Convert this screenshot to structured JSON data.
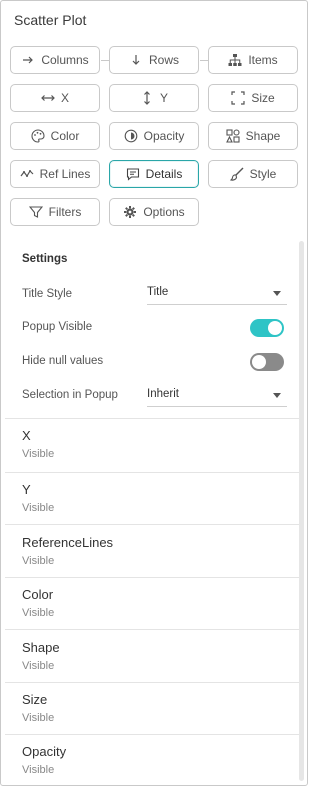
{
  "panel": {
    "title": "Scatter Plot"
  },
  "buttons": {
    "columns": "Columns",
    "rows": "Rows",
    "items": "Items",
    "x": "X",
    "y": "Y",
    "size": "Size",
    "color": "Color",
    "opacity": "Opacity",
    "shape": "Shape",
    "ref_lines": "Ref Lines",
    "details": "Details",
    "style": "Style",
    "filters": "Filters",
    "options": "Options"
  },
  "settings": {
    "heading": "Settings",
    "title_style": {
      "label": "Title Style",
      "value": "Title"
    },
    "popup_visible": {
      "label": "Popup Visible",
      "on": true
    },
    "hide_null": {
      "label": "Hide null values",
      "on": false
    },
    "selection_in_popup": {
      "label": "Selection in Popup",
      "value": "Inherit"
    }
  },
  "sections": [
    {
      "title": "X",
      "sub": "Visible"
    },
    {
      "title": "Y",
      "sub": "Visible"
    },
    {
      "title": "ReferenceLines",
      "sub": "Visible"
    },
    {
      "title": "Color",
      "sub": "Visible"
    },
    {
      "title": "Shape",
      "sub": "Visible"
    },
    {
      "title": "Size",
      "sub": "Visible"
    },
    {
      "title": "Opacity",
      "sub": "Visible"
    }
  ],
  "colors": {
    "accent": "#2ec4c6",
    "active_border": "#2aa6a8"
  }
}
